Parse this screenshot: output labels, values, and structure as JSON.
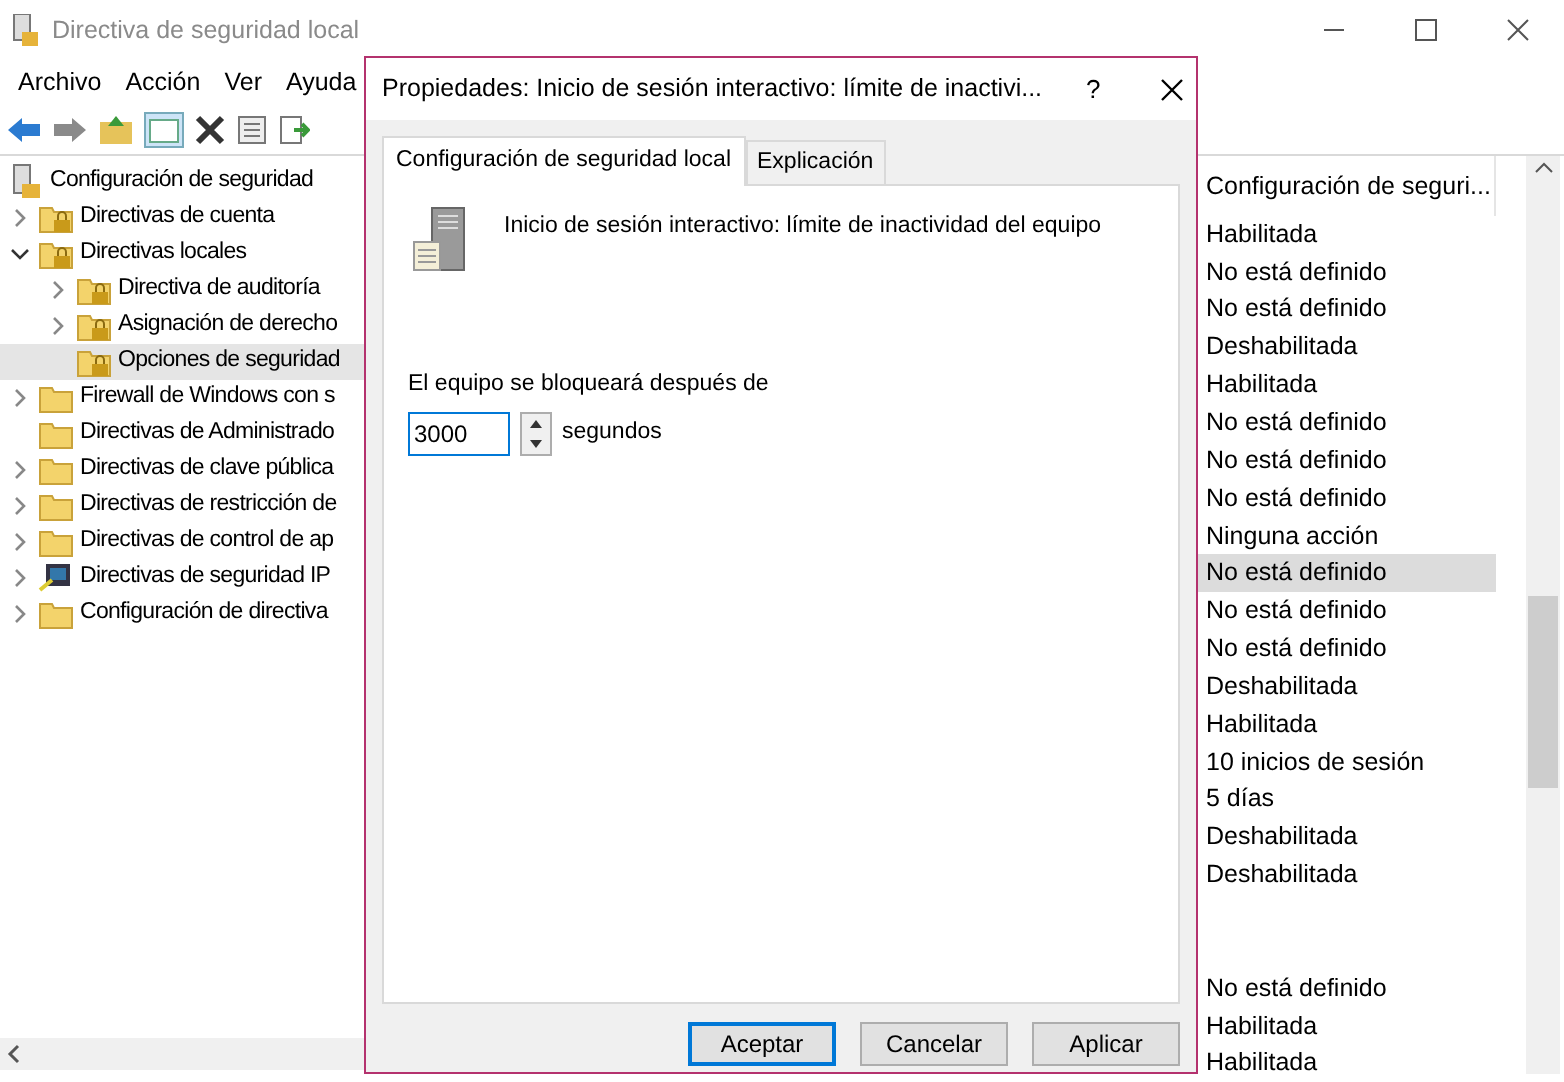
{
  "window": {
    "title": "Directiva de seguridad local"
  },
  "menu": [
    "Archivo",
    "Acción",
    "Ver",
    "Ayuda"
  ],
  "tree": {
    "label": "Configuración de seguridad",
    "children": [
      {
        "label": "Directivas de cuenta",
        "expanded": false,
        "selected": false,
        "kind": "folder"
      },
      {
        "label": "Directivas locales",
        "expanded": true,
        "selected": false,
        "kind": "folder",
        "children": [
          {
            "label": "Directiva de auditoría",
            "expanded": false,
            "selected": false
          },
          {
            "label": "Asignación de derecho",
            "expanded": false,
            "selected": false
          },
          {
            "label": "Opciones de seguridad",
            "selected": true
          }
        ]
      },
      {
        "label": "Firewall de Windows con s",
        "expanded": false,
        "selected": false,
        "kind": "plain"
      },
      {
        "label": "Directivas de Administrado",
        "selected": false,
        "kind": "plain"
      },
      {
        "label": "Directivas de clave pública",
        "expanded": false,
        "selected": false,
        "kind": "plain"
      },
      {
        "label": "Directivas de restricción de",
        "expanded": false,
        "selected": false,
        "kind": "plain"
      },
      {
        "label": "Directivas de control de ap",
        "expanded": false,
        "selected": false,
        "kind": "plain"
      },
      {
        "label": "Directivas de seguridad IP",
        "expanded": false,
        "selected": false,
        "kind": "ip"
      },
      {
        "label": "Configuración de directiva",
        "expanded": false,
        "selected": false,
        "kind": "plain"
      }
    ]
  },
  "settings_column": {
    "header": "Configuración de seguri...",
    "rows": [
      {
        "kind": "value",
        "value": "Habilitada",
        "selected": false
      },
      {
        "kind": "value",
        "value": "No está definido",
        "selected": false
      },
      {
        "kind": "value",
        "value": "No está definido",
        "selected": false
      },
      {
        "kind": "value",
        "value": "Deshabilitada",
        "selected": false
      },
      {
        "kind": "value",
        "value": "Habilitada",
        "selected": false
      },
      {
        "kind": "value",
        "value": "No está definido",
        "selected": false
      },
      {
        "kind": "value",
        "value": "No está definido",
        "selected": false
      },
      {
        "kind": "value",
        "value": "No está definido",
        "selected": false
      },
      {
        "kind": "value",
        "value": "Ninguna acción",
        "selected": false
      },
      {
        "kind": "value",
        "value": "No está definido",
        "selected": true
      },
      {
        "kind": "value",
        "value": "No está definido",
        "selected": false
      },
      {
        "kind": "value",
        "value": "No está definido",
        "selected": false
      },
      {
        "kind": "value",
        "value": "Deshabilitada",
        "selected": false
      },
      {
        "kind": "value",
        "value": "Habilitada",
        "selected": false
      },
      {
        "kind": "value",
        "value": "10 inicios de sesión",
        "selected": false
      },
      {
        "kind": "value",
        "value": "5 días",
        "selected": false
      },
      {
        "kind": "value",
        "value": "Deshabilitada",
        "selected": false
      },
      {
        "kind": "value",
        "value": "Deshabilitada",
        "selected": false
      },
      {
        "kind": "blank"
      },
      {
        "kind": "blank"
      },
      {
        "kind": "value",
        "value": "No está definido",
        "selected": false
      },
      {
        "kind": "value",
        "value": "Habilitada",
        "selected": false
      },
      {
        "kind": "value",
        "value": "Habilitada",
        "selected": false
      }
    ]
  },
  "dialog": {
    "title": "Propiedades: Inicio de sesión interactivo: límite de inactivi...",
    "help": "?",
    "tabs": [
      {
        "label": "Configuración de seguridad local",
        "selected": true
      },
      {
        "label": "Explicación",
        "selected": false
      }
    ],
    "policy_name": "Inicio de sesión interactivo: límite de inactividad del equipo",
    "field_label": "El equipo se bloqueará después de",
    "field_value": "3000",
    "unit": "segundos",
    "buttons": [
      {
        "label": "Aceptar",
        "default": true
      },
      {
        "label": "Cancelar",
        "default": false
      },
      {
        "label": "Aplicar",
        "default": false
      }
    ]
  }
}
